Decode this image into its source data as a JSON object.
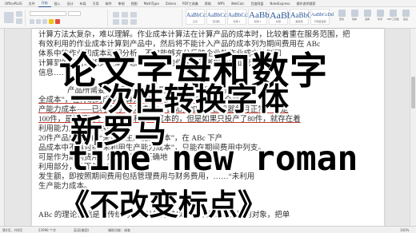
{
  "ribbon": {
    "tabs": [
      "OfficePLUS",
      "文件",
      "开始",
      "插入",
      "设计",
      "布局",
      "引用",
      "邮件",
      "审阅",
      "视图",
      "MathType",
      "Zotero",
      "PDF工具集",
      "帮助",
      "WPS",
      "iNetCalc",
      "百度网盘",
      "NoteExpress",
      "操作说明搜索"
    ],
    "active_tab": 2,
    "styles": [
      {
        "sample": "AaBbCcDd",
        "name": "正文"
      },
      {
        "sample": "AaBbCcDd",
        "name": "无间隔"
      },
      {
        "sample": "AaBbCcDd",
        "name": "标题 1"
      },
      {
        "sample": "AaBb",
        "name": "标题 2"
      },
      {
        "sample": "AaBbl",
        "name": "标题"
      },
      {
        "sample": "AaBbC",
        "name": "副标题"
      },
      {
        "sample": "AaBbCcDd",
        "name": "不明显强调"
      }
    ],
    "right_tools": [
      "查找",
      "替换",
      "选择",
      "听写",
      "PDF工具集",
      "签名"
    ]
  },
  "document": {
    "lines": [
      "计算方法太复杂，难以理解。作业成本计算法在计算产品的成本时，比较着重在服务范围，把",
      "有效利用的作业成本计算到产品中，然后将不能计入产品的成本列为期间费用在 ABc",
      "体系中的作业和成本动因分析，不仅能够充分反映企业的作业成本控制和",
      "计算到的是管理相关决策信息，又能够向作业管理者提供作业管理法",
      "信息……",
      "产品所需要的资源成本不过是为生产产品所以前的“完",
      "全成本”，在传统的成本计算方法下，企业的总成本包括全部生",
      "产能力成本——已利用的“投入成本”。比如，如果一台机器每月正常产量是",
      "100件，是按照这个生产能力和投入成本的，但是如果只投产了80件，就存在着",
      "利用能力成本。在 ABc 下产",
      "20件产品所对应的“未利用生产能力成本”，在 ABc 下产",
      "品成本中不再包括“未利用生产能力成本”，只能在期间费用中列支。",
      "可是作为期间费用，如果不能够正确地",
      "利用部分，从而使 ABc 法",
      "发生额，即按照期间费用包括管理费用与财务费用，……“未利用",
      "生产能力成本。",
      "",
      "ABc 的理论依据是：传统的成本计算方法以产品作为成本分配的对象，把单"
    ]
  },
  "status_bar": {
    "page": "第4页，共8页",
    "words": "23998 个字",
    "language": "英语(美国)",
    "accessibility": "辅助功能：调查",
    "zoom": "100%"
  },
  "overlay": {
    "line1": "论文字母和数字",
    "line2": "一次性转换字体",
    "line3": "新罗马",
    "line4": "time new roman",
    "line5": "《不改变标点》"
  }
}
